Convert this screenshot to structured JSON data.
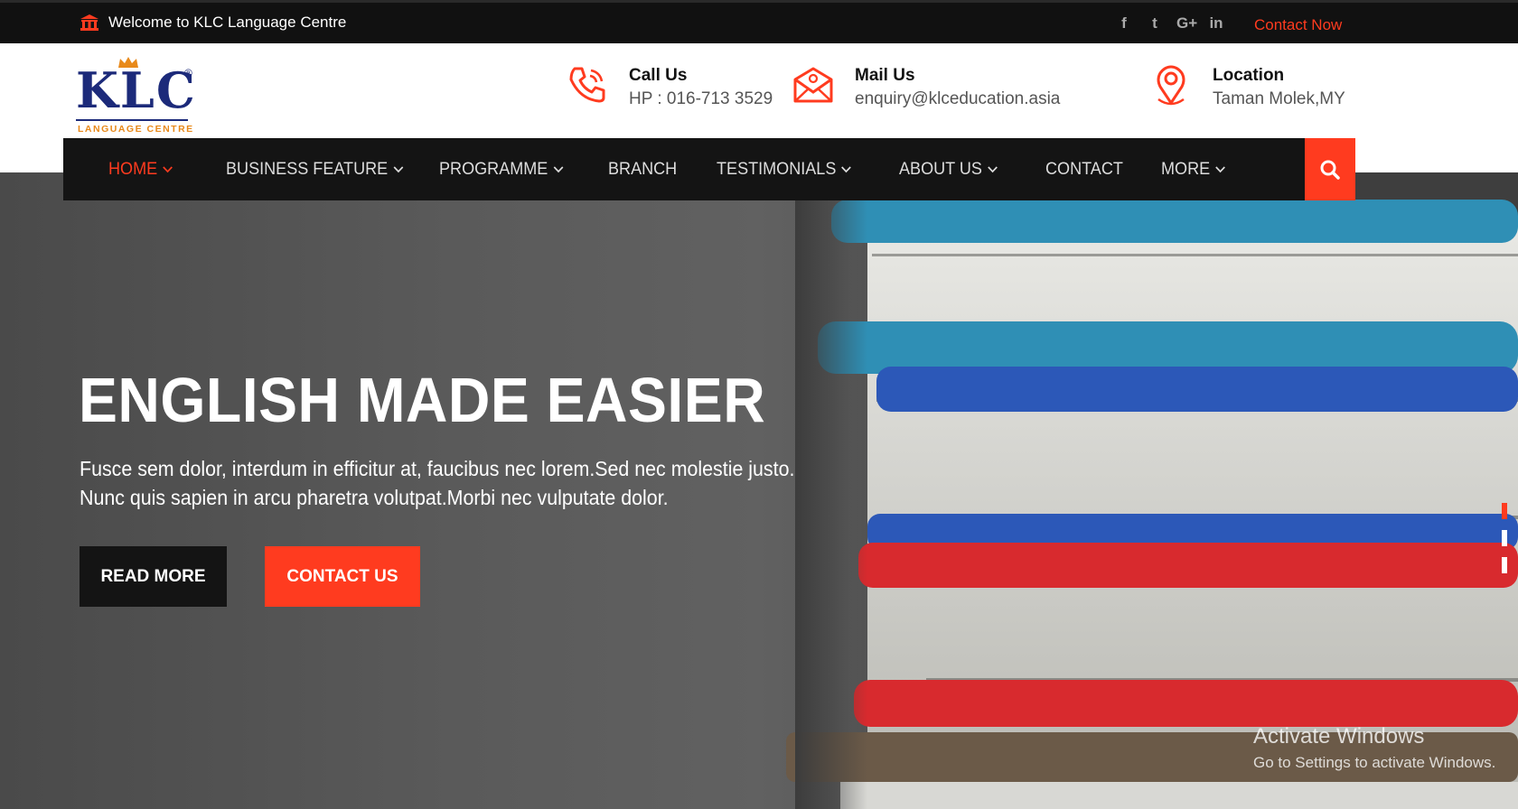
{
  "topbar": {
    "welcome": "Welcome to KLC Language Centre",
    "bank_icon": "bank-icon",
    "social": [
      {
        "icon": "facebook-icon",
        "glyph": "f"
      },
      {
        "icon": "twitter-icon",
        "glyph": "t"
      },
      {
        "icon": "google-plus-icon",
        "glyph": "G+"
      },
      {
        "icon": "linkedin-icon",
        "glyph": "in"
      }
    ],
    "contact_now": "Contact Now"
  },
  "logo": {
    "text": "KLC",
    "registered": "®",
    "subtitle": "LANGUAGE CENTRE"
  },
  "header": {
    "call": {
      "title": "Call Us",
      "value": "HP : 016-713 3529",
      "icon": "phone-icon"
    },
    "mail": {
      "title": "Mail Us",
      "value": "enquiry@klceducation.asia",
      "icon": "mail-icon"
    },
    "location": {
      "title": "Location",
      "value": "Taman Molek,MY",
      "icon": "location-pin-icon"
    }
  },
  "nav": {
    "items": [
      {
        "label": "HOME",
        "dropdown": true,
        "active": true
      },
      {
        "label": "BUSINESS FEATURE",
        "dropdown": true
      },
      {
        "label": "PROGRAMME",
        "dropdown": true
      },
      {
        "label": "BRANCH",
        "dropdown": false
      },
      {
        "label": "TESTIMONIALS",
        "dropdown": true
      },
      {
        "label": "ABOUT US",
        "dropdown": true
      },
      {
        "label": "CONTACT",
        "dropdown": false
      },
      {
        "label": "MORE",
        "dropdown": true
      }
    ],
    "search_icon": "search-icon"
  },
  "hero": {
    "title": "ENGLISH MADE EASIER",
    "text_line1": "Fusce sem dolor, interdum in efficitur at, faucibus nec lorem.Sed nec molestie justo.",
    "text_line2": "Nunc quis sapien in arcu pharetra volutpat.Morbi nec vulputate dolor.",
    "read_more": "READ MORE",
    "contact_us": "CONTACT US",
    "slides": 3,
    "active_slide": 1
  },
  "watermark": {
    "line1": "Activate Windows",
    "line2": "Go to Settings to activate Windows."
  },
  "colors": {
    "accent": "#ff3b1f",
    "dark": "#141414",
    "brand_blue": "#1c2a7a",
    "brand_orange": "#e8891a"
  }
}
